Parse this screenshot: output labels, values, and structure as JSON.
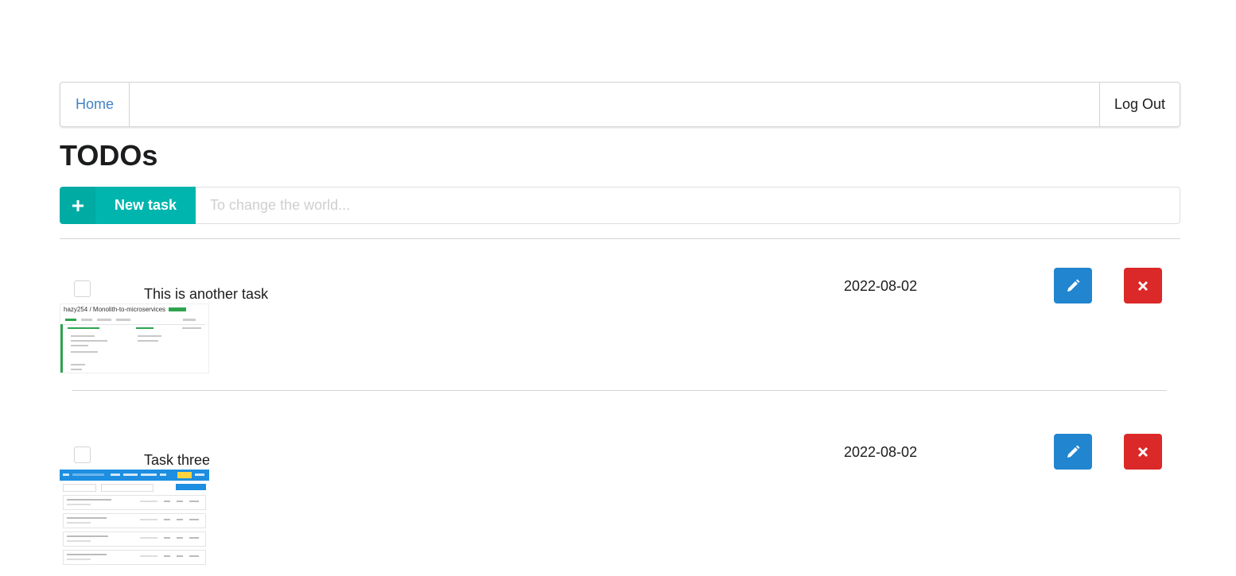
{
  "nav": {
    "home_label": "Home",
    "logout_label": "Log Out"
  },
  "page": {
    "title": "TODOs"
  },
  "new_task": {
    "button_label": "New task",
    "button_icon": "plus-icon",
    "input_placeholder": "To change the world...",
    "input_value": "",
    "accent_color": "#00b5ad"
  },
  "tasks": [
    {
      "title": "This is another task",
      "date": "2022-08-02",
      "checked": false,
      "image_text": "hazy254 / Monolith-to-microservices"
    },
    {
      "title": "Task three",
      "date": "2022-08-02",
      "checked": false
    }
  ],
  "colors": {
    "edit_button": "#2185d0",
    "delete_button": "#db2828",
    "link": "#4183c4"
  },
  "icons": {
    "edit": "pencil-icon",
    "delete": "close-icon"
  }
}
